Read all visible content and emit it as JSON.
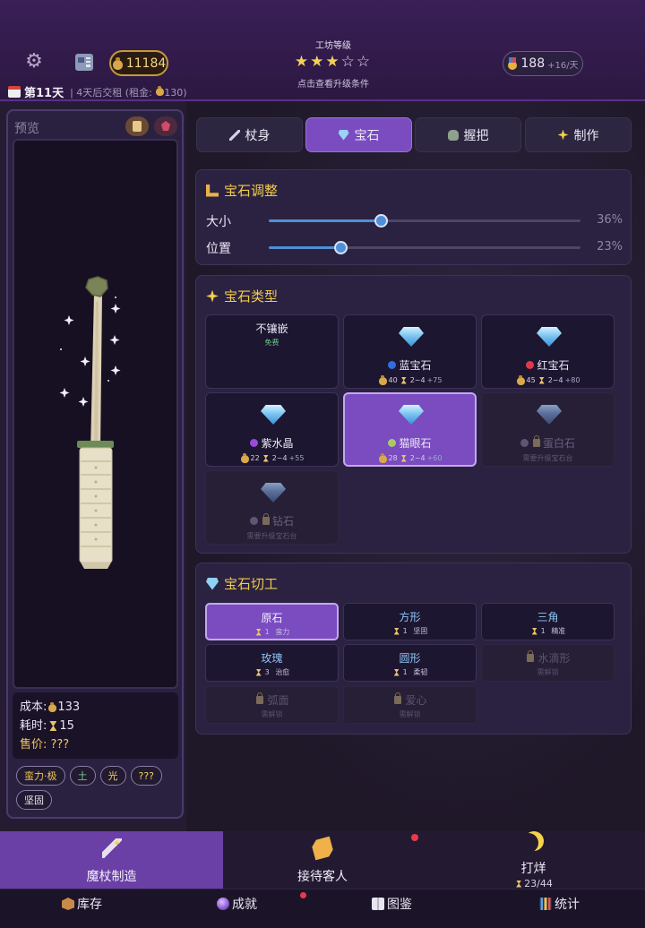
{
  "header": {
    "gold": "11184",
    "workshop_title": "工坊等级",
    "workshop_stars_on": "★★★",
    "workshop_stars_off": "☆☆",
    "workshop_stars_value": 3,
    "workshop_stars_max": 5,
    "workshop_hint": "点击查看升级条件",
    "reputation": "188",
    "reputation_rate": "+16/天",
    "day": "第11天",
    "rent_info": "| 4天后交租 (租金: ",
    "rent_amount": "130)"
  },
  "preview": {
    "label": "预览",
    "cost_label": "成本: ",
    "cost_value": "133",
    "time_label": "耗时: ",
    "time_value": "15",
    "price_label": "售价: ???",
    "tags": [
      {
        "text": "蛮力·极",
        "color": "gold"
      },
      {
        "text": "土",
        "color": "green"
      },
      {
        "text": "光",
        "color": "yellow"
      },
      {
        "text": "???",
        "color": "yellow"
      },
      {
        "text": "坚固",
        "color": "plain"
      }
    ]
  },
  "tabs": [
    {
      "label": "杖身",
      "icon": "staff-icon",
      "active": false
    },
    {
      "label": "宝石",
      "icon": "gem-icon",
      "active": true
    },
    {
      "label": "握把",
      "icon": "grip-icon",
      "active": false
    },
    {
      "label": "制作",
      "icon": "sparkle-icon",
      "active": false
    }
  ],
  "gem_adjust": {
    "title": "宝石调整",
    "size_label": "大小",
    "size_value": "36%",
    "size_fraction": 0.36,
    "position_label": "位置",
    "position_value": "23%",
    "position_fraction": 0.23
  },
  "gem_types": {
    "title": "宝石类型",
    "none": {
      "name": "不镶嵌",
      "sub": "免费"
    },
    "items": [
      {
        "name": "蓝宝石",
        "dot": "#2f6de0",
        "cost": "40",
        "time": "2~4",
        "bonus": "+75",
        "locked": false,
        "selected": false
      },
      {
        "name": "红宝石",
        "dot": "#e03a4a",
        "cost": "45",
        "time": "2~4",
        "bonus": "+80",
        "locked": false,
        "selected": false
      },
      {
        "name": "紫水晶",
        "dot": "#9a4ad8",
        "cost": "22",
        "time": "2~4",
        "bonus": "+55",
        "locked": false,
        "selected": false
      },
      {
        "name": "猫眼石",
        "dot": "#a8c86a",
        "cost": "28",
        "time": "2~4",
        "bonus": "+60",
        "locked": false,
        "selected": true
      },
      {
        "name": "蛋白石",
        "lock_hint": "需要升级宝石台",
        "locked": true
      },
      {
        "name": "钻石",
        "lock_hint": "需要升级宝石台",
        "locked": true
      }
    ]
  },
  "gem_cuts": {
    "title": "宝石切工",
    "items": [
      {
        "name": "原石",
        "num": "1",
        "effect": "蛮力",
        "selected": true
      },
      {
        "name": "方形",
        "num": "1",
        "effect": "坚固"
      },
      {
        "name": "三角",
        "num": "1",
        "effect": "精准"
      },
      {
        "name": "玫瑰",
        "num": "3",
        "effect": "治愈"
      },
      {
        "name": "圆形",
        "num": "1",
        "effect": "柔韧"
      },
      {
        "name": "水滴形",
        "hint": "需解锁",
        "locked": true
      },
      {
        "name": "弧面",
        "hint": "需解锁",
        "locked": true
      },
      {
        "name": "爱心",
        "hint": "需解锁",
        "locked": true
      }
    ]
  },
  "bottom_nav": {
    "craft": "魔杖制造",
    "customers": "接待客人",
    "close": "打烊",
    "close_progress": "23/44"
  },
  "sub_nav": {
    "inventory": "库存",
    "achievements": "成就",
    "codex": "图鉴",
    "stats": "统计"
  }
}
